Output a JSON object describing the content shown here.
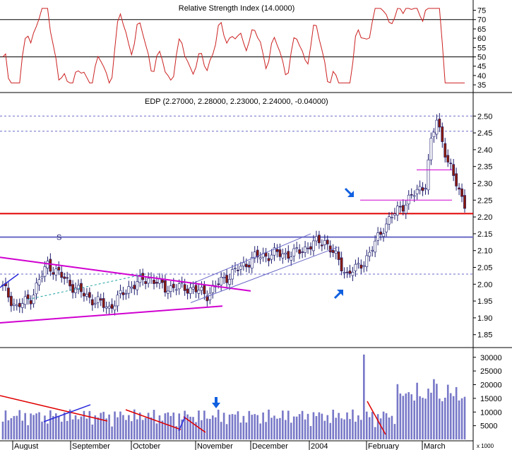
{
  "indicator": {
    "title": "Relative Strength Index (14.0000)",
    "ticks": [
      35,
      40,
      45,
      50,
      55,
      60,
      65,
      70,
      75
    ],
    "ylim": [
      32,
      79
    ],
    "ref_lines": [
      70,
      50
    ]
  },
  "chart_data": {
    "type": "candlestick",
    "title": "EDP (2.27000, 2.28000, 2.23000, 2.24000, -0.04000)",
    "ylim": [
      1.82,
      2.53
    ],
    "yticks": [
      "1.85",
      "1.90",
      "1.95",
      "2.00",
      "2.05",
      "2.10",
      "2.15",
      "2.20",
      "2.25",
      "2.30",
      "2.35",
      "2.40",
      "2.45",
      "2.50"
    ],
    "x_labels": [
      "August",
      "September",
      "October",
      "November",
      "December",
      "2004",
      "February",
      "March"
    ],
    "horizontal_lines": [
      {
        "value": 2.21,
        "color": "#e00000"
      },
      {
        "value": 2.14,
        "color": "#6a6ac8"
      },
      {
        "value": 2.5,
        "color": "#6a6ac8",
        "dashed": true
      },
      {
        "value": 2.455,
        "color": "#6a6ac8",
        "dashed": true
      },
      {
        "value": 2.03,
        "color": "#6a6ac8",
        "dashed": true
      }
    ],
    "annotation_s": "S"
  },
  "volume": {
    "ticks": [
      "5000",
      "10000",
      "15000",
      "20000",
      "25000",
      "30000"
    ],
    "unit_label": "x 1000",
    "ylim": [
      0,
      32000
    ]
  },
  "colors": {
    "up": "#ffffff",
    "down": "#8b1a0a",
    "outline": "#1c1c6e",
    "rsi": "#cc2020",
    "trend_magenta": "#d000d0",
    "support_red": "#e00000",
    "volume_bar": "#7878c8",
    "arrow_blue": "#1060e0",
    "grid_dash": "#6a6ac8"
  }
}
